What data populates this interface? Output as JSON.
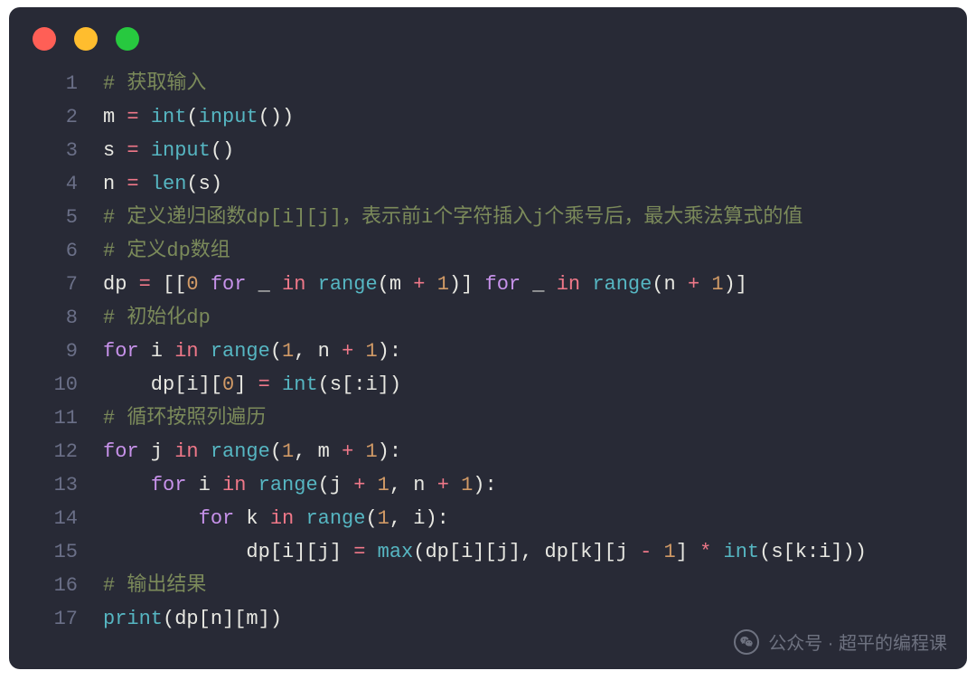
{
  "code": {
    "lines": [
      {
        "n": "1",
        "tokens": [
          {
            "cls": "tok-comment",
            "t": "# 获取输入"
          }
        ]
      },
      {
        "n": "2",
        "tokens": [
          {
            "cls": "tok-default",
            "t": "m "
          },
          {
            "cls": "tok-op",
            "t": "="
          },
          {
            "cls": "tok-default",
            "t": " "
          },
          {
            "cls": "tok-builtin",
            "t": "int"
          },
          {
            "cls": "tok-default",
            "t": "("
          },
          {
            "cls": "tok-builtin",
            "t": "input"
          },
          {
            "cls": "tok-default",
            "t": "())"
          }
        ]
      },
      {
        "n": "3",
        "tokens": [
          {
            "cls": "tok-default",
            "t": "s "
          },
          {
            "cls": "tok-op",
            "t": "="
          },
          {
            "cls": "tok-default",
            "t": " "
          },
          {
            "cls": "tok-builtin",
            "t": "input"
          },
          {
            "cls": "tok-default",
            "t": "()"
          }
        ]
      },
      {
        "n": "4",
        "tokens": [
          {
            "cls": "tok-default",
            "t": "n "
          },
          {
            "cls": "tok-op",
            "t": "="
          },
          {
            "cls": "tok-default",
            "t": " "
          },
          {
            "cls": "tok-builtin",
            "t": "len"
          },
          {
            "cls": "tok-default",
            "t": "(s)"
          }
        ]
      },
      {
        "n": "5",
        "tokens": [
          {
            "cls": "tok-comment",
            "t": "# 定义递归函数dp[i][j]，表示前i个字符插入j个乘号后，最大乘法算式的值"
          }
        ]
      },
      {
        "n": "6",
        "tokens": [
          {
            "cls": "tok-comment",
            "t": "# 定义dp数组"
          }
        ]
      },
      {
        "n": "7",
        "tokens": [
          {
            "cls": "tok-default",
            "t": "dp "
          },
          {
            "cls": "tok-op",
            "t": "="
          },
          {
            "cls": "tok-default",
            "t": " [["
          },
          {
            "cls": "tok-num",
            "t": "0"
          },
          {
            "cls": "tok-default",
            "t": " "
          },
          {
            "cls": "tok-kw",
            "t": "for"
          },
          {
            "cls": "tok-default",
            "t": " _ "
          },
          {
            "cls": "tok-op",
            "t": "in"
          },
          {
            "cls": "tok-default",
            "t": " "
          },
          {
            "cls": "tok-builtin",
            "t": "range"
          },
          {
            "cls": "tok-default",
            "t": "(m "
          },
          {
            "cls": "tok-op",
            "t": "+"
          },
          {
            "cls": "tok-default",
            "t": " "
          },
          {
            "cls": "tok-num",
            "t": "1"
          },
          {
            "cls": "tok-default",
            "t": ")] "
          },
          {
            "cls": "tok-kw",
            "t": "for"
          },
          {
            "cls": "tok-default",
            "t": " _ "
          },
          {
            "cls": "tok-op",
            "t": "in"
          },
          {
            "cls": "tok-default",
            "t": " "
          },
          {
            "cls": "tok-builtin",
            "t": "range"
          },
          {
            "cls": "tok-default",
            "t": "(n "
          },
          {
            "cls": "tok-op",
            "t": "+"
          },
          {
            "cls": "tok-default",
            "t": " "
          },
          {
            "cls": "tok-num",
            "t": "1"
          },
          {
            "cls": "tok-default",
            "t": ")]"
          }
        ]
      },
      {
        "n": "8",
        "tokens": [
          {
            "cls": "tok-comment",
            "t": "# 初始化dp"
          }
        ]
      },
      {
        "n": "9",
        "tokens": [
          {
            "cls": "tok-kw",
            "t": "for"
          },
          {
            "cls": "tok-default",
            "t": " i "
          },
          {
            "cls": "tok-op",
            "t": "in"
          },
          {
            "cls": "tok-default",
            "t": " "
          },
          {
            "cls": "tok-builtin",
            "t": "range"
          },
          {
            "cls": "tok-default",
            "t": "("
          },
          {
            "cls": "tok-num",
            "t": "1"
          },
          {
            "cls": "tok-default",
            "t": ", n "
          },
          {
            "cls": "tok-op",
            "t": "+"
          },
          {
            "cls": "tok-default",
            "t": " "
          },
          {
            "cls": "tok-num",
            "t": "1"
          },
          {
            "cls": "tok-default",
            "t": "):"
          }
        ]
      },
      {
        "n": "10",
        "tokens": [
          {
            "cls": "tok-default",
            "t": "    dp[i]["
          },
          {
            "cls": "tok-num",
            "t": "0"
          },
          {
            "cls": "tok-default",
            "t": "] "
          },
          {
            "cls": "tok-op",
            "t": "="
          },
          {
            "cls": "tok-default",
            "t": " "
          },
          {
            "cls": "tok-builtin",
            "t": "int"
          },
          {
            "cls": "tok-default",
            "t": "(s[:i])"
          }
        ]
      },
      {
        "n": "11",
        "tokens": [
          {
            "cls": "tok-comment",
            "t": "# 循环按照列遍历"
          }
        ]
      },
      {
        "n": "12",
        "tokens": [
          {
            "cls": "tok-kw",
            "t": "for"
          },
          {
            "cls": "tok-default",
            "t": " j "
          },
          {
            "cls": "tok-op",
            "t": "in"
          },
          {
            "cls": "tok-default",
            "t": " "
          },
          {
            "cls": "tok-builtin",
            "t": "range"
          },
          {
            "cls": "tok-default",
            "t": "("
          },
          {
            "cls": "tok-num",
            "t": "1"
          },
          {
            "cls": "tok-default",
            "t": ", m "
          },
          {
            "cls": "tok-op",
            "t": "+"
          },
          {
            "cls": "tok-default",
            "t": " "
          },
          {
            "cls": "tok-num",
            "t": "1"
          },
          {
            "cls": "tok-default",
            "t": "):"
          }
        ]
      },
      {
        "n": "13",
        "tokens": [
          {
            "cls": "tok-default",
            "t": "    "
          },
          {
            "cls": "tok-kw",
            "t": "for"
          },
          {
            "cls": "tok-default",
            "t": " i "
          },
          {
            "cls": "tok-op",
            "t": "in"
          },
          {
            "cls": "tok-default",
            "t": " "
          },
          {
            "cls": "tok-builtin",
            "t": "range"
          },
          {
            "cls": "tok-default",
            "t": "(j "
          },
          {
            "cls": "tok-op",
            "t": "+"
          },
          {
            "cls": "tok-default",
            "t": " "
          },
          {
            "cls": "tok-num",
            "t": "1"
          },
          {
            "cls": "tok-default",
            "t": ", n "
          },
          {
            "cls": "tok-op",
            "t": "+"
          },
          {
            "cls": "tok-default",
            "t": " "
          },
          {
            "cls": "tok-num",
            "t": "1"
          },
          {
            "cls": "tok-default",
            "t": "):"
          }
        ]
      },
      {
        "n": "14",
        "tokens": [
          {
            "cls": "tok-default",
            "t": "        "
          },
          {
            "cls": "tok-kw",
            "t": "for"
          },
          {
            "cls": "tok-default",
            "t": " k "
          },
          {
            "cls": "tok-op",
            "t": "in"
          },
          {
            "cls": "tok-default",
            "t": " "
          },
          {
            "cls": "tok-builtin",
            "t": "range"
          },
          {
            "cls": "tok-default",
            "t": "("
          },
          {
            "cls": "tok-num",
            "t": "1"
          },
          {
            "cls": "tok-default",
            "t": ", i):"
          }
        ]
      },
      {
        "n": "15",
        "tokens": [
          {
            "cls": "tok-default",
            "t": "            dp[i][j] "
          },
          {
            "cls": "tok-op",
            "t": "="
          },
          {
            "cls": "tok-default",
            "t": " "
          },
          {
            "cls": "tok-builtin",
            "t": "max"
          },
          {
            "cls": "tok-default",
            "t": "(dp[i][j], dp[k][j "
          },
          {
            "cls": "tok-op",
            "t": "-"
          },
          {
            "cls": "tok-default",
            "t": " "
          },
          {
            "cls": "tok-num",
            "t": "1"
          },
          {
            "cls": "tok-default",
            "t": "] "
          },
          {
            "cls": "tok-op",
            "t": "*"
          },
          {
            "cls": "tok-default",
            "t": " "
          },
          {
            "cls": "tok-builtin",
            "t": "int"
          },
          {
            "cls": "tok-default",
            "t": "(s[k:i]))"
          }
        ]
      },
      {
        "n": "16",
        "tokens": [
          {
            "cls": "tok-comment",
            "t": "# 输出结果"
          }
        ]
      },
      {
        "n": "17",
        "tokens": [
          {
            "cls": "tok-builtin",
            "t": "print"
          },
          {
            "cls": "tok-default",
            "t": "(dp[n][m])"
          }
        ]
      }
    ]
  },
  "watermark": {
    "label": "公众号 · 超平的编程课"
  }
}
